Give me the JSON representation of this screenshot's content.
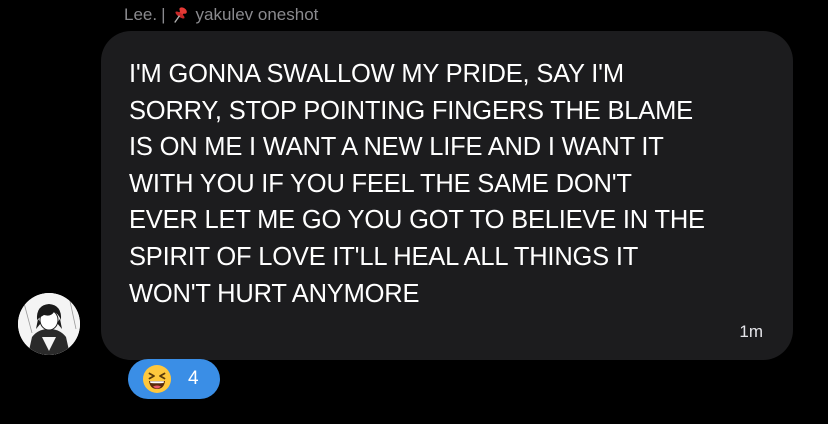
{
  "reply_header": {
    "sender": "Lee.",
    "separator": "|",
    "pin_icon": "pushpin-icon",
    "thread_name": "yakulev oneshot"
  },
  "message": {
    "lines": [
      "I'M GONNA SWALLOW MY PRIDE, SAY I'M",
      "SORRY, STOP POINTING FINGERS THE BLAME",
      "IS ON ME I WANT A NEW LIFE AND I WANT IT",
      "WITH YOU IF YOU FEEL THE SAME DON'T",
      "EVER LET ME GO YOU GOT TO BELIEVE IN THE",
      "SPIRIT OF LOVE IT'LL HEAL ALL THINGS IT",
      "WON'T HURT ANYMORE"
    ],
    "timestamp": "1m",
    "bubble_color": "#1c1c1e",
    "text_color": "#ffffff"
  },
  "avatar": {
    "icon": "user-avatar-icon"
  },
  "reaction": {
    "emoji": "grinning-squinting-face-icon",
    "count": "4",
    "color": "#3a8ee6"
  }
}
